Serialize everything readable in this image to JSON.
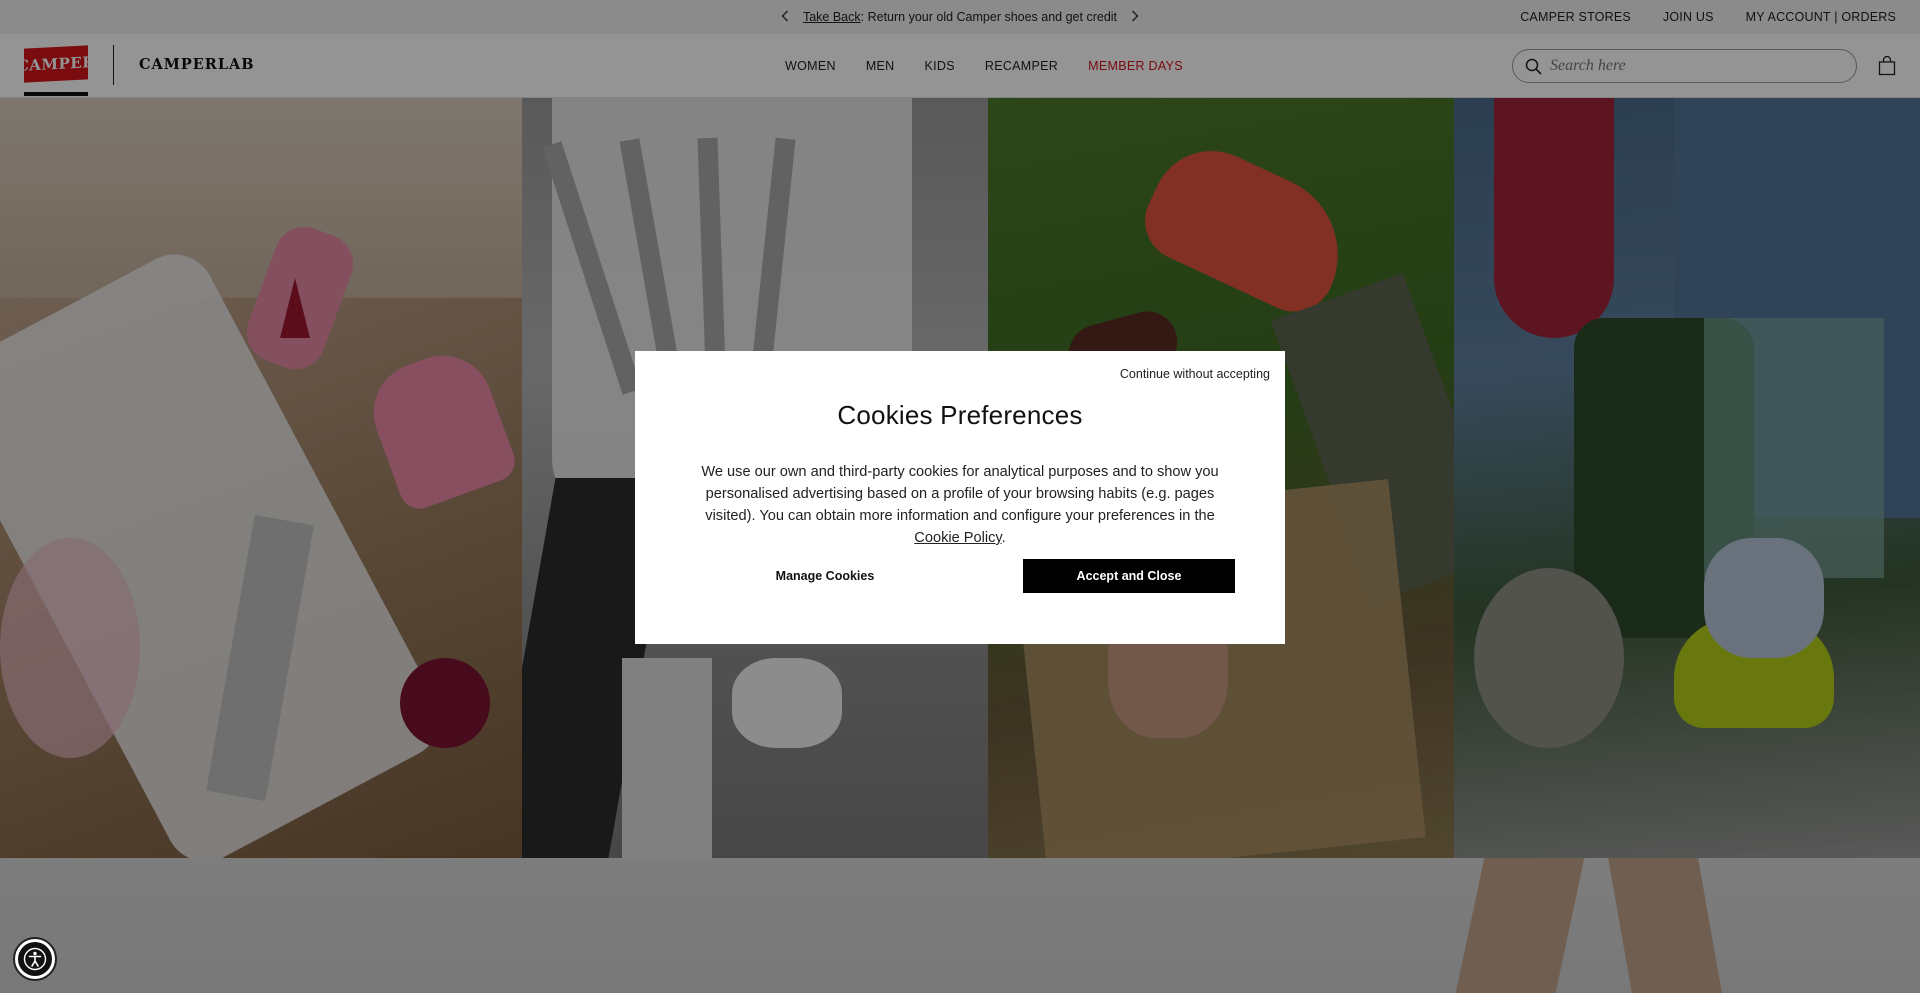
{
  "announcement": {
    "prev_icon": "chevron-left-icon",
    "link_text": "Take Back",
    "message": ": Return your old Camper shoes and get credit",
    "next_icon": "chevron-right-icon"
  },
  "top_links": {
    "stores": "CAMPER STORES",
    "join": "JOIN US",
    "account": "MY ACCOUNT | ORDERS"
  },
  "header": {
    "logo_text": "CAMPER",
    "sub_brand": "CAMPERLAB",
    "nav": {
      "women": "WOMEN",
      "men": "MEN",
      "kids": "KIDS",
      "recamper": "RECAMPER",
      "member_days": "MEMBER DAYS"
    },
    "search_placeholder": "Search here",
    "search_icon": "search-icon",
    "bag_icon": "shopping-bag-icon"
  },
  "colors": {
    "brand_red": "#d2141b",
    "accept_button": "#000000",
    "overlay": "rgba(0,0,0,0.42)"
  },
  "cookie_modal": {
    "skip": "Continue without accepting",
    "title": "Cookies Preferences",
    "body_before_link": "We use our own and third-party cookies for analytical purposes and to show you personalised advertising based on a profile of your browsing habits (e.g. pages visited). You can obtain more information and configure your preferences in the ",
    "policy_link": "Cookie Policy",
    "body_after_link": ".",
    "manage_label": "Manage Cookies",
    "accept_label": "Accept and Close"
  },
  "accessibility": {
    "icon": "accessibility-icon"
  }
}
